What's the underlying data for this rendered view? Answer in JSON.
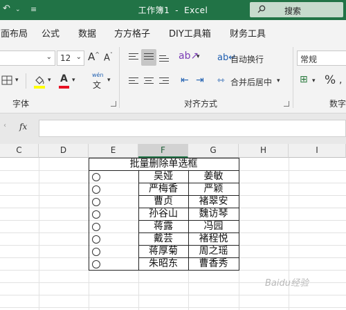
{
  "titlebar": {
    "title": "工作簿1",
    "separator": "-",
    "app": "Excel",
    "search_label": "搜索",
    "color": "#217346"
  },
  "menu": [
    "页面布局",
    "公式",
    "数据",
    "方方格子",
    "DIY工具箱",
    "财务工具"
  ],
  "ribbon": {
    "font_size": "12",
    "grow_font": "A",
    "shrink_font": "A",
    "wen_label": "wén",
    "wen_char": "文",
    "wrap_text": "自动换行",
    "merge_center": "合并后居中",
    "number_format": "常规",
    "percent": "%",
    "groups": {
      "font": "字体",
      "alignment": "对齐方式",
      "number": "数字"
    },
    "fill_color": "#ffff00",
    "font_color": "#e81123"
  },
  "formula": {
    "fx": "fx",
    "value": ""
  },
  "columns": [
    "C",
    "D",
    "E",
    "F",
    "G",
    "H",
    "I"
  ],
  "table": {
    "title": "批量删除单选框",
    "rows": [
      [
        "吴娅",
        "姜敏"
      ],
      [
        "严梅香",
        "严颖"
      ],
      [
        "曹贞",
        "褚翠安"
      ],
      [
        "孙谷山",
        "魏访琴"
      ],
      [
        "蒋露",
        "冯园"
      ],
      [
        "戴芸",
        "褚程悦"
      ],
      [
        "蒋厚菊",
        "周之瑶"
      ],
      [
        "朱昭东",
        "曹香秀"
      ]
    ]
  },
  "watermark": "Baidu经验"
}
